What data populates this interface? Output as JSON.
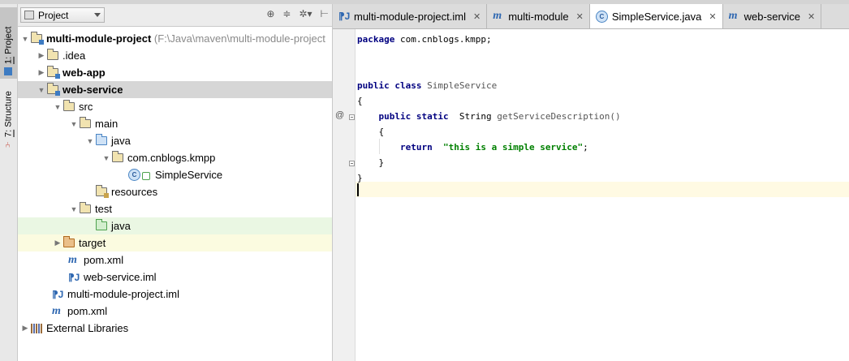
{
  "sidebar_tabs": {
    "project_num": "1:",
    "project_label": "Project",
    "structure_num": "7:",
    "structure_label": "Structure"
  },
  "panel": {
    "view_selector": "Project"
  },
  "tree": {
    "root_name": "multi-module-project",
    "root_path": "(F:\\Java\\maven\\multi-module-project",
    "idea": ".idea",
    "web_app": "web-app",
    "web_service": "web-service",
    "src": "src",
    "main": "main",
    "java": "java",
    "package": "com.cnblogs.kmpp",
    "simple_service": "SimpleService",
    "resources": "resources",
    "test": "test",
    "test_java": "java",
    "target": "target",
    "pom_xml": "pom.xml",
    "web_service_iml": "web-service.iml",
    "root_iml": "multi-module-project.iml",
    "root_pom": "pom.xml",
    "external_libraries": "External Libraries"
  },
  "tabs": [
    {
      "label": "multi-module-project.iml",
      "icon": "iml-file-icon"
    },
    {
      "label": "multi-module",
      "icon": "maven-icon"
    },
    {
      "label": "SimpleService.java",
      "icon": "class-icon",
      "active": true
    },
    {
      "label": "web-service",
      "icon": "maven-icon"
    }
  ],
  "code": {
    "package_kw": "package",
    "package_name": "com.cnblogs.kmpp;",
    "public_kw": "public",
    "class_kw": "class",
    "class_name": "SimpleService",
    "open_brace": "{",
    "static_kw": "static",
    "return_type": "String",
    "method_name": "getServiceDescription()",
    "return_kw": "return",
    "return_value": "\"this is a simple service\"",
    "semicolon": ";",
    "close_brace": "}"
  },
  "colors": {
    "keyword": "#000080",
    "string": "#008000",
    "current_line": "#fffae3",
    "selected_row": "#d6d6d6"
  }
}
